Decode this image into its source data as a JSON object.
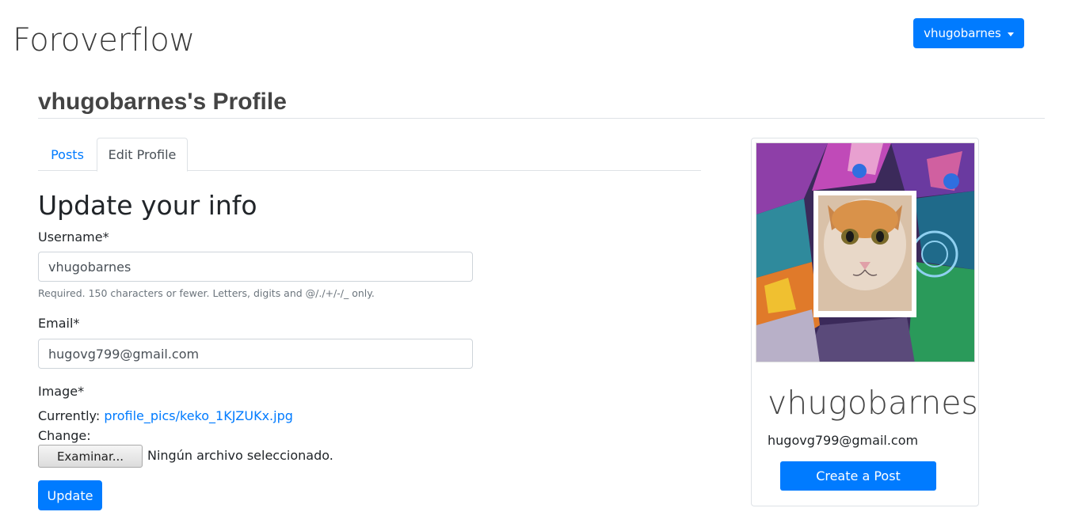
{
  "app": {
    "brand": "Foroverflow"
  },
  "user_menu": {
    "label": "vhugobarnes",
    "icon": "caret-down-icon"
  },
  "page": {
    "title": "vhugobarnes's Profile"
  },
  "tabs": [
    {
      "label": "Posts",
      "active": false
    },
    {
      "label": "Edit Profile",
      "active": true
    }
  ],
  "form": {
    "title": "Update your info",
    "username": {
      "label": "Username*",
      "value": "vhugobarnes",
      "help": "Required. 150 characters or fewer. Letters, digits and @/./+/-/_ only."
    },
    "email": {
      "label": "Email*",
      "value": "hugovg799@gmail.com"
    },
    "image": {
      "label": "Image*",
      "currently_label": "Currently:",
      "current_file": "profile_pics/keko_1KJZUKx.jpg",
      "change_label": "Change:",
      "browse_label": "Examinar...",
      "no_file_text": "Ningún archivo seleccionado."
    },
    "submit_label": "Update"
  },
  "profile_card": {
    "username": "vhugobarnes",
    "email": "hugovg799@gmail.com",
    "create_post_label": "Create a Post",
    "avatar_icon": "cat-photo-collage"
  },
  "colors": {
    "primary": "#007bff",
    "text": "#212529",
    "muted": "#6c757d",
    "border": "#dee2e6"
  }
}
